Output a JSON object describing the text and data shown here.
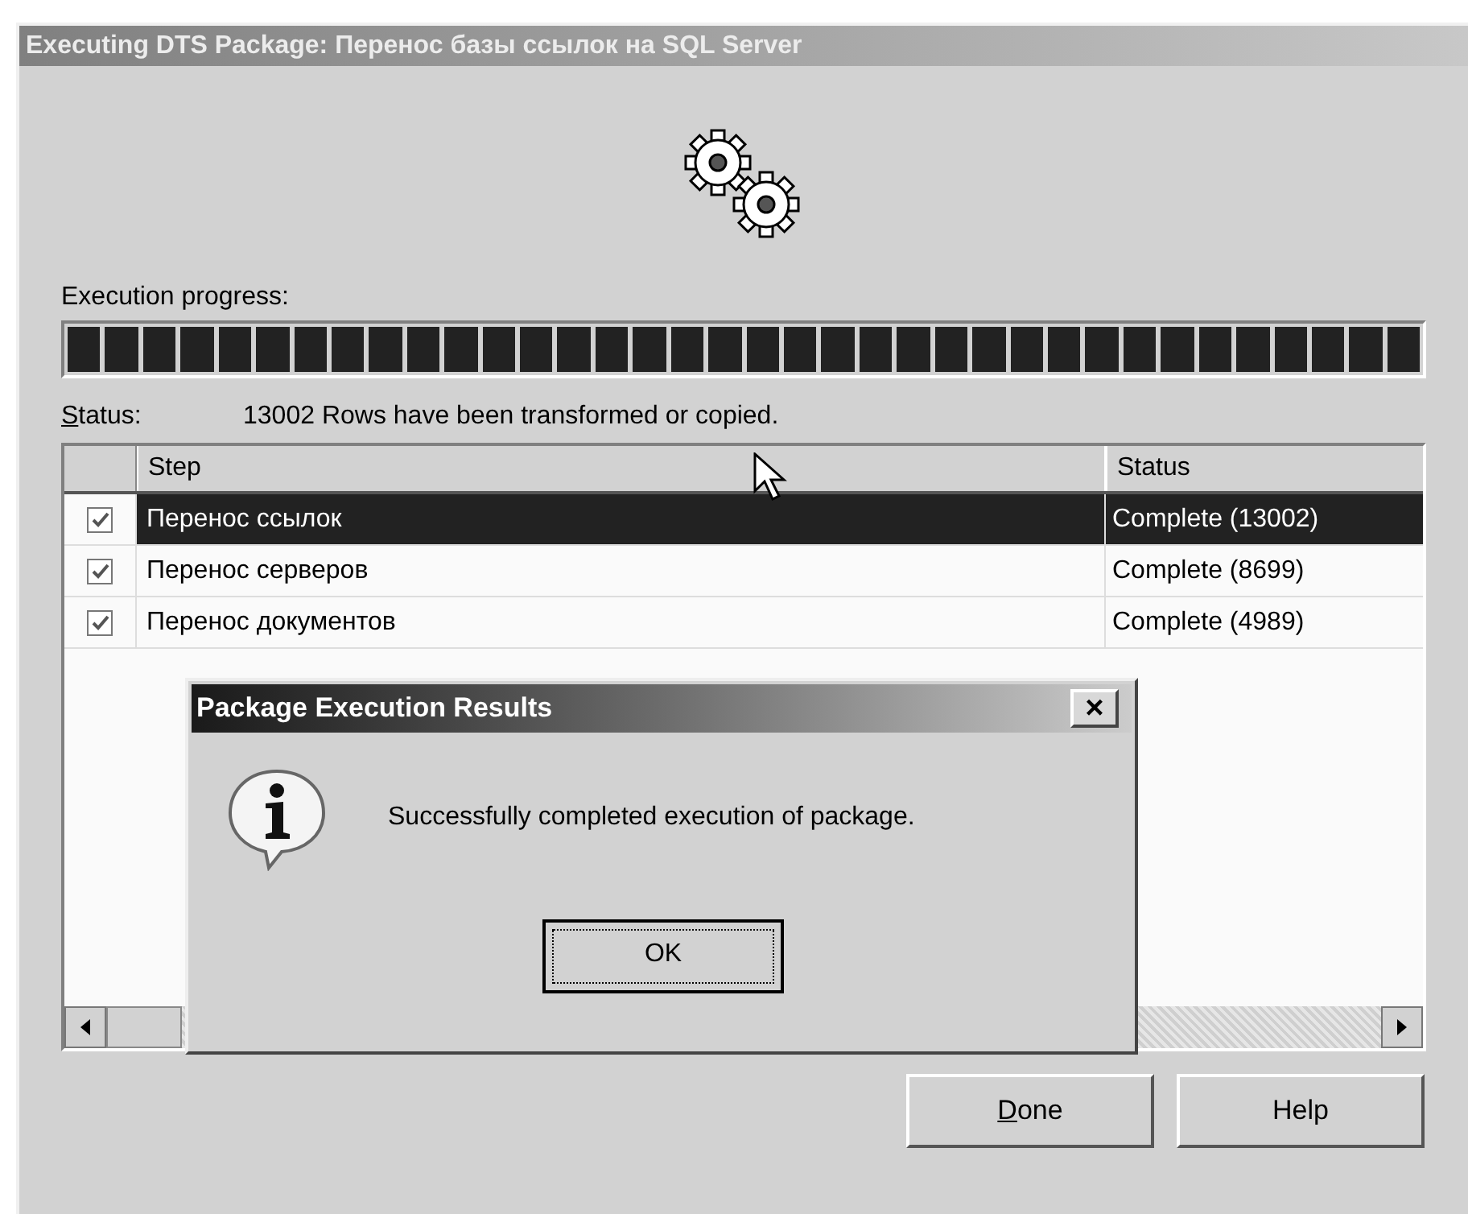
{
  "window": {
    "title": "Executing DTS Package: Перенос базы ссылок на SQL Server"
  },
  "progress": {
    "label": "Execution progress:",
    "level": 1
  },
  "status": {
    "label": "Status:",
    "label_underline_first": true,
    "text": "13002 Rows have been transformed or copied."
  },
  "table": {
    "columns": [
      "Step",
      "Status"
    ],
    "rows": [
      {
        "step": "Перенос ссылок",
        "status": "Complete (13002)",
        "checked": true,
        "selected": true
      },
      {
        "step": "Перенос серверов",
        "status": "Complete (8699)",
        "checked": true,
        "selected": false
      },
      {
        "step": "Перенос документов",
        "status": "Complete (4989)",
        "checked": true,
        "selected": false
      }
    ]
  },
  "dialog": {
    "title": "Package Execution Results",
    "close": "×",
    "message": "Successfully completed execution of package.",
    "button": "OK"
  },
  "buttons": [
    {
      "label": "Done",
      "underline_first": true
    },
    {
      "label": "Help",
      "underline_first": false
    }
  ]
}
